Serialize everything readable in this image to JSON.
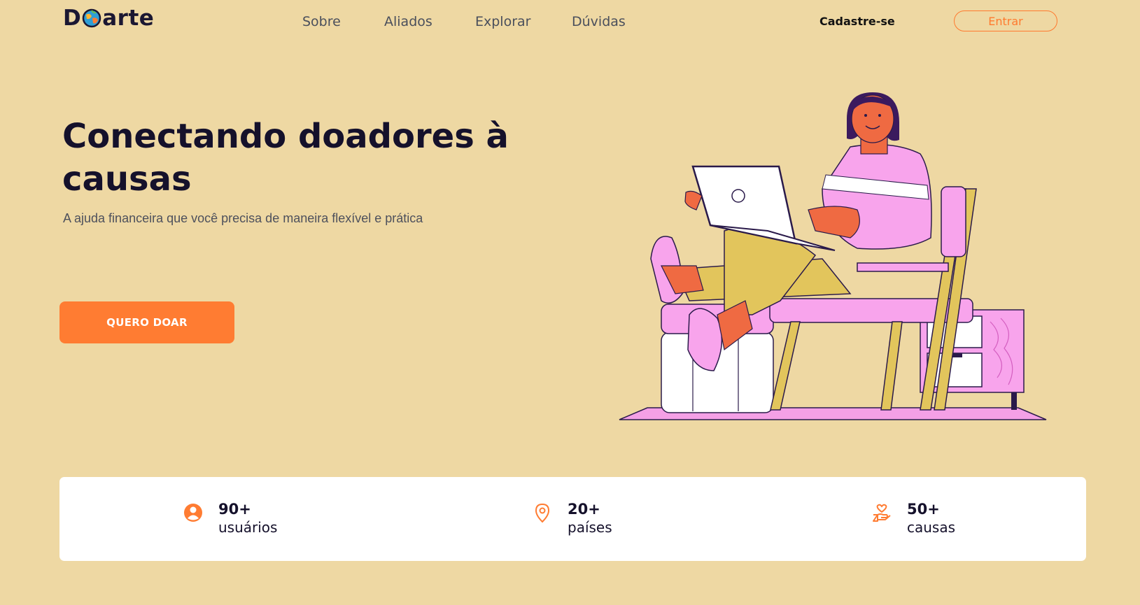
{
  "header": {
    "logo_left": "D",
    "logo_right": "arte",
    "nav": [
      "Sobre",
      "Aliados",
      "Explorar",
      "Dúvidas"
    ],
    "signup_label": "Cadastre-se",
    "login_label": "Entrar"
  },
  "hero": {
    "title": "Conectando doadores à causas",
    "subtitle": "A ajuda financeira que você precisa de maneira flexível e prática",
    "cta_label": "QUERO DOAR"
  },
  "stats": [
    {
      "icon": "user-circle-icon",
      "value": "90+",
      "label": "usuários"
    },
    {
      "icon": "map-pin-icon",
      "value": "20+",
      "label": "países"
    },
    {
      "icon": "heart-hand-icon",
      "value": "50+",
      "label": "causas"
    }
  ],
  "colors": {
    "background": "#eed8a3",
    "accent": "#ff7c32",
    "text_dark": "#15112b",
    "card": "#ffffff"
  }
}
